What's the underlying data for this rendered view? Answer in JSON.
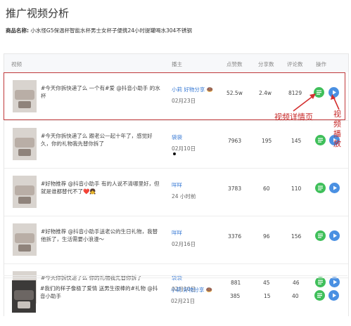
{
  "page_title": "推广视频分析",
  "product": {
    "label": "商品名称:",
    "name": "小水怪G5保温杯智能水杯男士女杯子便携24小时提罐喝水304不锈钢"
  },
  "columns": [
    "视频",
    "播主",
    "点赞数",
    "分享数",
    "评论数",
    "操作"
  ],
  "rows": [
    {
      "desc": "#今天你拆快递了么 一个有#爱 @抖音小助手 的水杯",
      "anchor": "小莉 好物分享",
      "anchor_emoji": "🍩",
      "date": "02月23日",
      "likes": "52.5w",
      "shares": "2.4w",
      "comments": "8129"
    },
    {
      "desc": "#今天你拆快递了么 跟老公一起十年了，感觉好久，你的礼物我先替你拆了",
      "anchor": "袋袋",
      "anchor_emoji": "",
      "date": "02月10日",
      "likes": "7963",
      "shares": "195",
      "comments": "145"
    },
    {
      "desc": "#好物推荐 @抖音小助手 有的人说不清哪里好，但就是谁都替代不了❤️👧",
      "anchor": "咩咩",
      "anchor_emoji": "",
      "date": "24 小时前",
      "likes": "3783",
      "shares": "60",
      "comments": "110"
    },
    {
      "desc": "#好物推荐 @抖音小助手送老公的生日礼物，我替他拆了，生活需要小浪漫～",
      "anchor": "咩咩",
      "anchor_emoji": "",
      "date": "02月16日",
      "likes": "3376",
      "shares": "96",
      "comments": "156"
    },
    {
      "desc": "#今天你拆快递了么 你的礼物我先替你拆了",
      "anchor": "袋袋",
      "anchor_emoji": "",
      "date": "02月10日",
      "likes": "881",
      "shares": "45",
      "comments": "46"
    },
    {
      "desc": "#我们的样子像极了爱情 送男生很棒的#礼物 @抖音小助手",
      "anchor": "小莉 好物分享",
      "anchor_emoji": "🍩",
      "date": "02月21日",
      "likes": "385",
      "shares": "15",
      "comments": "40"
    }
  ],
  "annotations": {
    "detail": "视频详情页",
    "play": "视频播放"
  },
  "colors": {
    "highlight": "#c0393b",
    "detail_btn": "#3fbf5a",
    "play_btn": "#4a90e2",
    "link": "#3a7bd5"
  }
}
